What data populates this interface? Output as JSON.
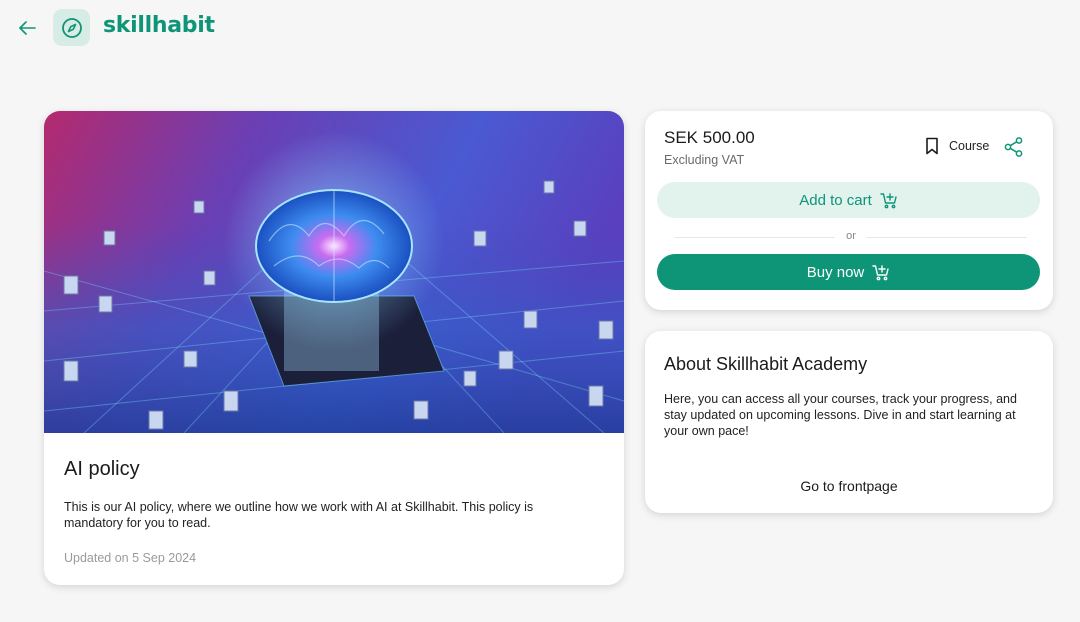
{
  "header": {
    "brand": "skillhabit"
  },
  "course": {
    "title": "AI policy",
    "description": "This is our AI policy, where we outline how we work with AI at Skillhabit. This policy is mandatory for you to read.",
    "updated": "Updated on 5 Sep 2024"
  },
  "purchase": {
    "price": "SEK 500.00",
    "vat_note": "Excluding VAT",
    "type_label": "Course",
    "add_to_cart_label": "Add to cart",
    "or_label": "or",
    "buy_now_label": "Buy now"
  },
  "about": {
    "title": "About Skillhabit Academy",
    "text": "Here, you can access all your courses, track your progress, and stay updated on upcoming lessons. Dive in and start learning at your own pace!",
    "link_label": "Go to frontpage"
  },
  "colors": {
    "brand": "#0e9577",
    "brand_light": "#e2f2ed",
    "background": "#f6f6f6"
  },
  "icons": {
    "back": "arrow-left-icon",
    "logo": "compass-icon",
    "bookmark": "bookmark-icon",
    "share": "share-icon",
    "cart": "cart-plus-icon"
  }
}
